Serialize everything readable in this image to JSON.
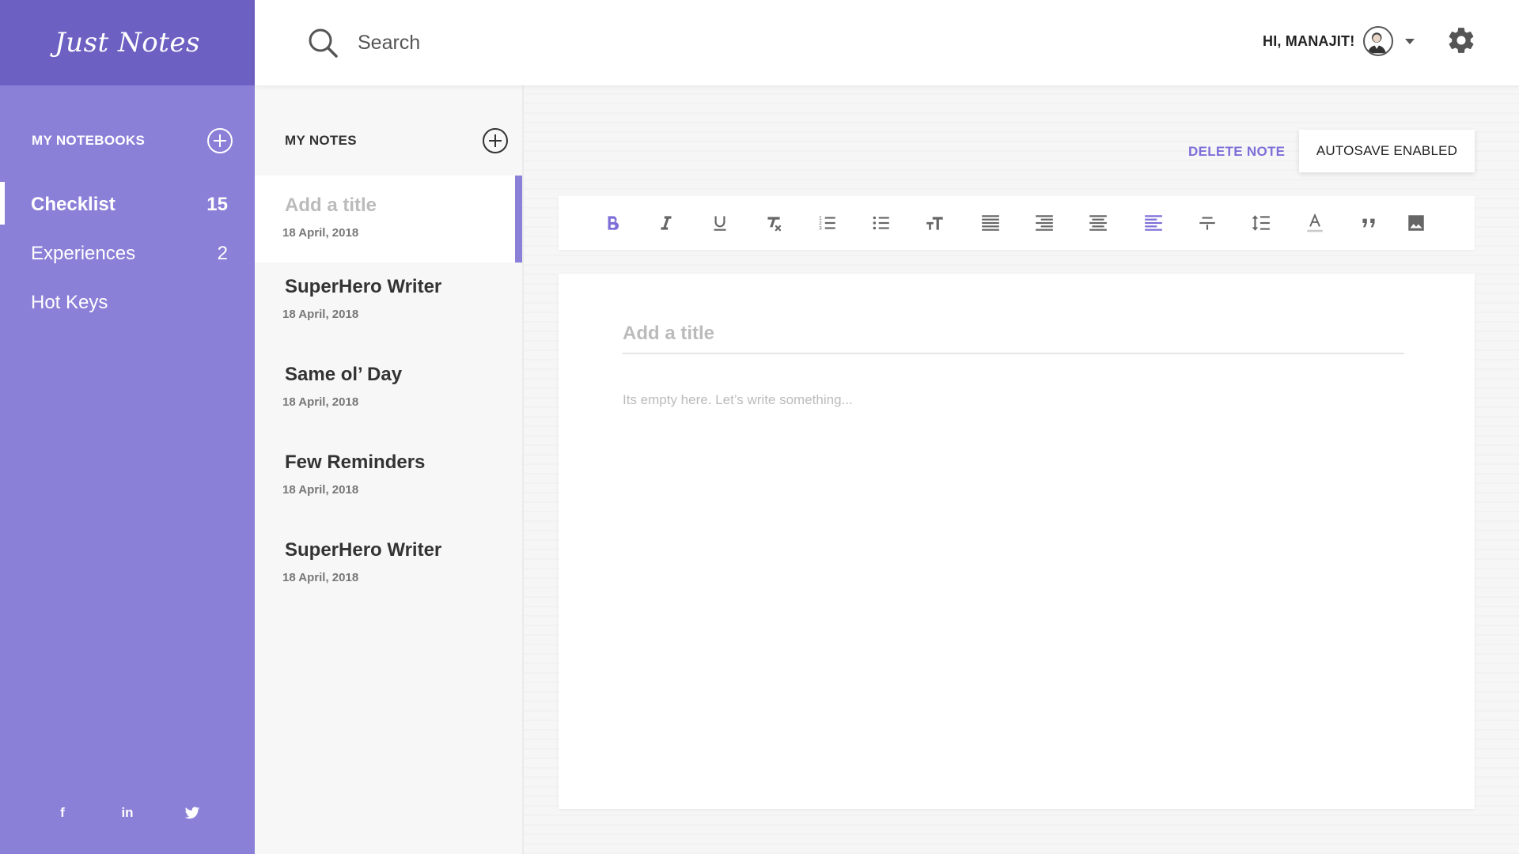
{
  "app": {
    "name": "Just Notes"
  },
  "header": {
    "search_placeholder": "Search",
    "greeting": "HI, MANAJIT!"
  },
  "sidebar": {
    "section_label": "MY NOTEBOOKS",
    "items": [
      {
        "label": "Checklist",
        "count": "15",
        "active": true
      },
      {
        "label": "Experiences",
        "count": "2",
        "active": false
      },
      {
        "label": "Hot Keys",
        "count": "",
        "active": false
      }
    ],
    "social": [
      {
        "icon": "facebook-icon",
        "glyph": "f"
      },
      {
        "icon": "linkedin-icon",
        "glyph": "in"
      },
      {
        "icon": "twitter-icon",
        "glyph": "twitter"
      }
    ]
  },
  "notes": {
    "section_label": "MY NOTES",
    "items": [
      {
        "title": "Add a title",
        "date": "18 April, 2018",
        "active": true
      },
      {
        "title": "SuperHero Writer",
        "date": "18 April, 2018",
        "active": false
      },
      {
        "title": "Same ol’ Day",
        "date": "18 April, 2018",
        "active": false
      },
      {
        "title": "Few Reminders",
        "date": "18 April, 2018",
        "active": false
      },
      {
        "title": "SuperHero Writer",
        "date": "18 April, 2018",
        "active": false
      }
    ]
  },
  "editor": {
    "delete_label": "DELETE NOTE",
    "autosave_label": "AUTOSAVE ENABLED",
    "title_placeholder": "Add a title",
    "body_placeholder": "Its empty here. Let’s write something...",
    "toolbar": [
      {
        "icon": "bold-icon",
        "active": true
      },
      {
        "icon": "italic-icon",
        "active": false
      },
      {
        "icon": "underline-icon",
        "active": false
      },
      {
        "icon": "clear-format-icon",
        "active": false
      },
      {
        "icon": "ordered-list-icon",
        "active": false
      },
      {
        "icon": "bullet-list-icon",
        "active": false
      },
      {
        "icon": "text-size-icon",
        "active": false
      },
      {
        "icon": "align-justify-icon",
        "active": false
      },
      {
        "icon": "align-right-icon",
        "active": false
      },
      {
        "icon": "align-center-icon",
        "active": false
      },
      {
        "icon": "align-left-icon",
        "active": true
      },
      {
        "icon": "strikethrough-icon",
        "active": false
      },
      {
        "icon": "line-height-icon",
        "active": false
      },
      {
        "icon": "text-color-icon",
        "active": false
      },
      {
        "icon": "quote-icon",
        "active": false
      },
      {
        "icon": "image-icon",
        "active": false
      }
    ]
  },
  "colors": {
    "accent": "#7d6fd8",
    "sidebar": "#8a80d8",
    "brand_bar": "#6c60c2",
    "icon_gray": "#666666"
  }
}
